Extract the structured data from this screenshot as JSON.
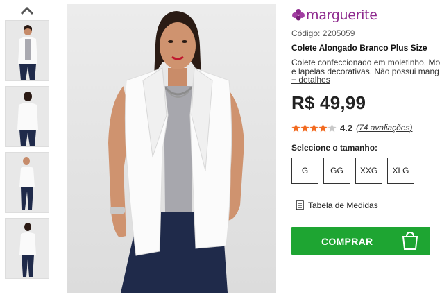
{
  "brand": {
    "name": "marguerite",
    "color": "#8e2a8e"
  },
  "product": {
    "code": "Código: 2205059",
    "title": "Colete Alongado Branco Plus Size",
    "description_lines": [
      "Colete confeccionado em moletinho. Mo",
      "e lapelas decorativas. Não possui mang"
    ],
    "more_link": "+ detalhes",
    "price": "R$ 49,99",
    "rating": {
      "value": "4.2",
      "count_text": "(74 avaliações)",
      "stars_filled": 4,
      "stars_total": 5,
      "star_color": "#f26b21"
    }
  },
  "sizes": {
    "label": "Selecione o tamanho:",
    "options": [
      "G",
      "GG",
      "XXG",
      "XLG"
    ]
  },
  "size_chart": {
    "label": "Tabela de Medidas",
    "icon": "document-icon"
  },
  "buy_button": {
    "label": "COMPRAR",
    "icon": "shopping-bag-icon",
    "color": "#1ea532"
  },
  "gallery": {
    "thumbnails": [
      "front-view",
      "back-view",
      "side-view",
      "back-view-full"
    ],
    "up_icon": "chevron-up-icon"
  }
}
